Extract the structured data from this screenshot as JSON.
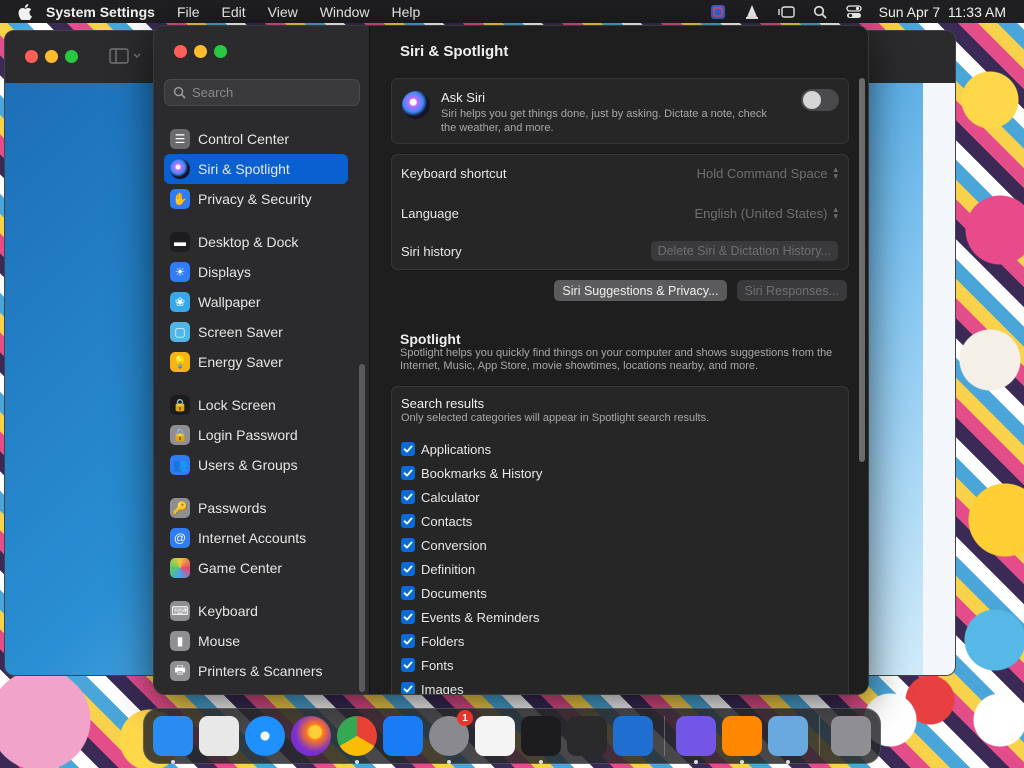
{
  "menubar": {
    "app_name": "System Settings",
    "items": [
      "File",
      "Edit",
      "View",
      "Window",
      "Help"
    ],
    "clock": "Sun Apr 7  11:33 AM"
  },
  "settings": {
    "search_placeholder": "Search",
    "sidebar": [
      {
        "label": "Control Center",
        "icon": "control-center-icon",
        "color": "#6a6a6e"
      },
      {
        "label": "Siri & Spotlight",
        "icon": "siri-icon",
        "color": "#7c4dff",
        "active": true
      },
      {
        "label": "Privacy & Security",
        "icon": "hand-icon",
        "color": "#2f7cf6"
      },
      {
        "gap": true
      },
      {
        "label": "Desktop & Dock",
        "icon": "dock-icon",
        "color": "#1c1c1e"
      },
      {
        "label": "Displays",
        "icon": "sun-icon",
        "color": "#2f7cf6"
      },
      {
        "label": "Wallpaper",
        "icon": "flower-icon",
        "color": "#38a9e8"
      },
      {
        "label": "Screen Saver",
        "icon": "screen-saver-icon",
        "color": "#50b6e8"
      },
      {
        "label": "Energy Saver",
        "icon": "bulb-icon",
        "color": "#f5b316"
      },
      {
        "gap": true
      },
      {
        "label": "Lock Screen",
        "icon": "lock-icon",
        "color": "#1c1c1e"
      },
      {
        "label": "Login Password",
        "icon": "lock-icon",
        "color": "#8e8e93"
      },
      {
        "label": "Users & Groups",
        "icon": "users-icon",
        "color": "#2f7cf6"
      },
      {
        "gap": true
      },
      {
        "label": "Passwords",
        "icon": "key-icon",
        "color": "#8e8e93"
      },
      {
        "label": "Internet Accounts",
        "icon": "at-icon",
        "color": "#2f7cf6"
      },
      {
        "label": "Game Center",
        "icon": "game-center-icon",
        "color": "#e8e8e8"
      },
      {
        "gap": true
      },
      {
        "label": "Keyboard",
        "icon": "keyboard-icon",
        "color": "#8e8e93"
      },
      {
        "label": "Mouse",
        "icon": "mouse-icon",
        "color": "#8e8e93"
      },
      {
        "label": "Printers & Scanners",
        "icon": "printer-icon",
        "color": "#8e8e93"
      }
    ],
    "title": "Siri & Spotlight",
    "ask_siri": {
      "title": "Ask Siri",
      "description": "Siri helps you get things done, just by asking. Dictate a note, check the weather, and more.",
      "enabled": false
    },
    "rows": [
      {
        "label": "Keyboard shortcut",
        "value": "Hold Command Space"
      },
      {
        "label": "Language",
        "value": "English (United States)"
      },
      {
        "label": "Siri history",
        "button": "Delete Siri & Dictation History..."
      }
    ],
    "buttons": {
      "suggestions": "Siri Suggestions & Privacy...",
      "responses": "Siri Responses..."
    },
    "spotlight": {
      "title": "Spotlight",
      "description": "Spotlight helps you quickly find things on your computer and shows suggestions from the Internet, Music, App Store, movie showtimes, locations nearby, and more.",
      "results_title": "Search results",
      "results_desc": "Only selected categories will appear in Spotlight search results.",
      "categories": [
        "Applications",
        "Bookmarks & History",
        "Calculator",
        "Contacts",
        "Conversion",
        "Definition",
        "Documents",
        "Events & Reminders",
        "Folders",
        "Fonts",
        "Images"
      ]
    }
  },
  "dock": {
    "apps": [
      {
        "name": "finder",
        "color": "#2a8cf0",
        "running": true
      },
      {
        "name": "launchpad",
        "color": "#e8e8e8",
        "running": false
      },
      {
        "name": "safari",
        "color": "#1e90ff",
        "running": false
      },
      {
        "name": "firefox",
        "color": "#ff7a1a",
        "running": false
      },
      {
        "name": "chrome",
        "color": "#f3f3f3",
        "running": true
      },
      {
        "name": "app-store",
        "color": "#1a7cf5",
        "running": false
      },
      {
        "name": "system-settings",
        "color": "#8a8a8e",
        "running": true,
        "badge": "1"
      },
      {
        "name": "textedit",
        "color": "#f4f4f4",
        "running": false
      },
      {
        "name": "terminal",
        "color": "#1c1c1e",
        "running": true
      },
      {
        "name": "garageband",
        "color": "#2a2a2c",
        "running": false
      },
      {
        "name": "vscode",
        "color": "#1e6fd0",
        "running": false
      },
      {
        "sep": true
      },
      {
        "name": "viber",
        "color": "#7356e6",
        "running": true
      },
      {
        "name": "vlc",
        "color": "#ff8800",
        "running": true
      },
      {
        "name": "preview",
        "color": "#6aa8e0",
        "running": true
      },
      {
        "sep": true
      },
      {
        "name": "trash",
        "color": "#8e8e93",
        "running": false
      }
    ]
  }
}
